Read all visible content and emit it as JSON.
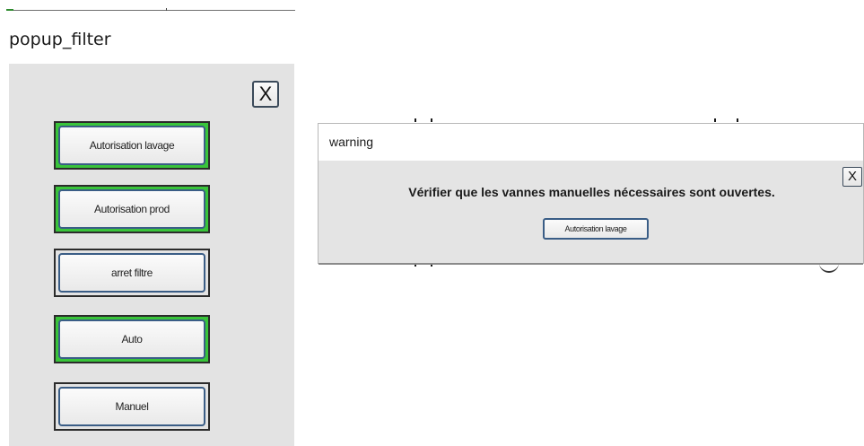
{
  "popup": {
    "title": "popup_filter",
    "close_label": "X",
    "buttons": [
      {
        "label": "Autorisation lavage",
        "state": "active"
      },
      {
        "label": "Autorisation prod",
        "state": "active"
      },
      {
        "label": "arret filtre",
        "state": "inactive"
      },
      {
        "label": "Auto",
        "state": "active"
      },
      {
        "label": "Manuel",
        "state": "inactive"
      }
    ]
  },
  "warning": {
    "title": "warning",
    "close_label": "X",
    "message": "Vérifier que les vannes manuelles nécessaires sont ouvertes.",
    "button_label": "Autorisation lavage"
  },
  "colors": {
    "active_frame": "#39c43a",
    "inactive_frame": "#e3e3e3",
    "panel_background": "#e3e3e3",
    "button_border": "#3a5d86"
  }
}
